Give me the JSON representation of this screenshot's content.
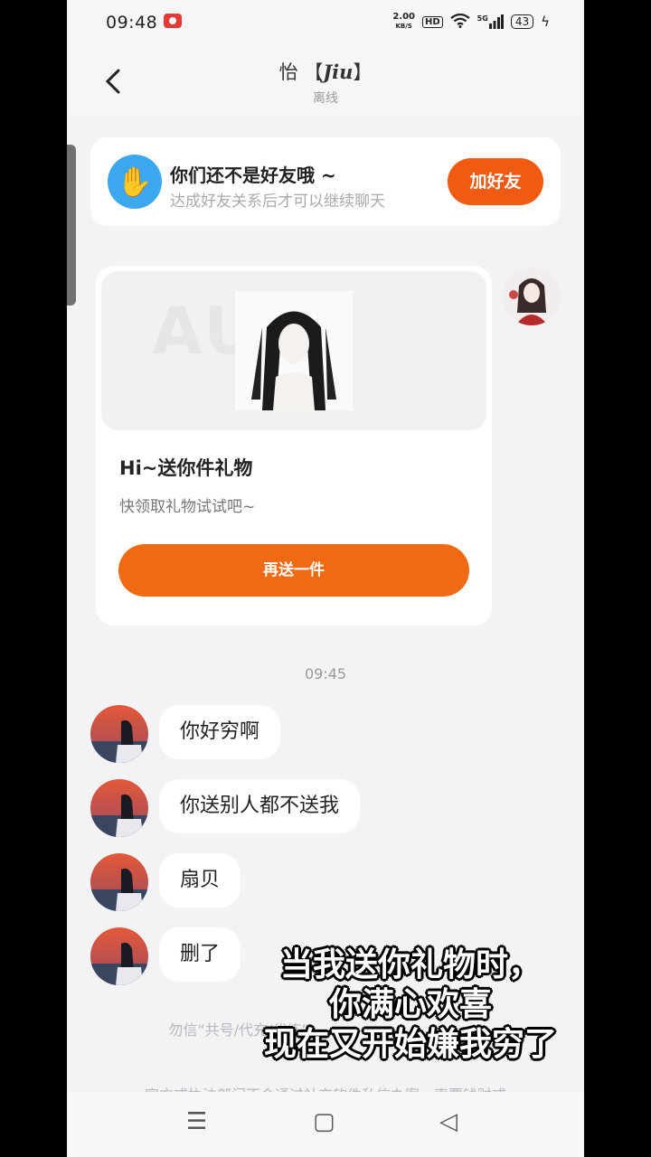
{
  "statusbar": {
    "time": "09:48",
    "netspeed_top": "2.00",
    "netspeed_bottom": "KB/S",
    "hd": "HD",
    "signal": "5G",
    "battery": "43"
  },
  "header": {
    "title_main": "怡 【",
    "title_jiu": "Jiu",
    "title_end": "】",
    "status": "离线"
  },
  "friend_banner": {
    "title": "你们还不是好友哦 ~",
    "subtitle": "达成好友关系后才可以继续聊天",
    "button": "加好友"
  },
  "gift_card": {
    "watermark": "AU",
    "title": "Hi~送你件礼物",
    "subtitle": "快领取礼物试试吧~",
    "button": "再送一件"
  },
  "timestamp": "09:45",
  "messages": [
    {
      "text": "你好穷啊"
    },
    {
      "text": "你送别人都不送我"
    },
    {
      "text": "扇贝"
    },
    {
      "text": "删了"
    }
  ],
  "notices": [
    "勿信“共号/代充/代练”",
    "官方或执法部门不会通过社交软件私信办案、索要钱财或"
  ],
  "caption": {
    "line1": "当我送你礼物时，",
    "line2": "你满心欢喜",
    "line3": "现在又开始嫌我穷了"
  },
  "navbar": {
    "menu_icon": "☰",
    "home_icon": "▢",
    "back_icon": "◁"
  },
  "colors": {
    "accent": "#f05a12",
    "friend_icon": "#3ba7ee",
    "background": "#f3f3f6"
  }
}
